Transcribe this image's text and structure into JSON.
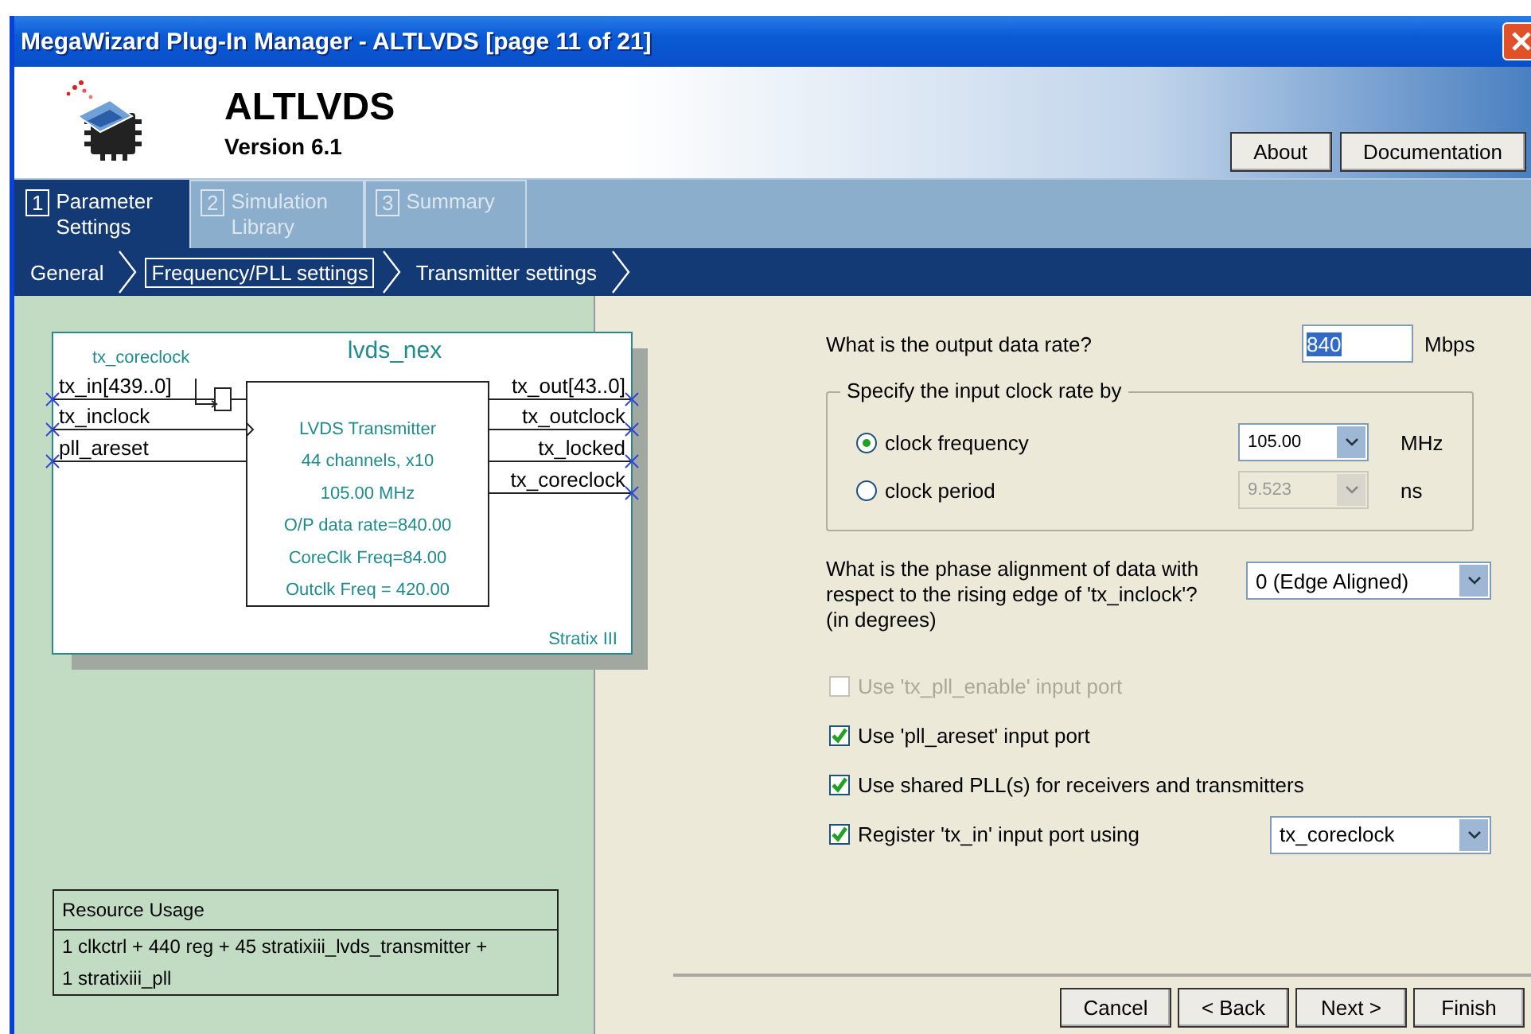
{
  "window": {
    "title": "MegaWizard Plug-In Manager - ALTLVDS [page 11 of 21]"
  },
  "header": {
    "title": "ALTLVDS",
    "version": "Version 6.1",
    "buttons": [
      "About",
      "Documentation"
    ]
  },
  "steps": [
    {
      "number": "1",
      "label": "Parameter Settings",
      "selected": true
    },
    {
      "number": "2",
      "label": "Simulation Library",
      "selected": false
    },
    {
      "number": "3",
      "label": "Summary",
      "selected": false
    }
  ],
  "breadcrumb": [
    {
      "label": "General",
      "selected": false
    },
    {
      "label": "Frequency/PLL settings",
      "selected": true
    },
    {
      "label": "Transmitter settings",
      "selected": false
    }
  ],
  "diagram": {
    "name": "lvds_nex",
    "clock_label": "tx_coreclock",
    "inputs": [
      "tx_in[439..0]",
      "tx_inclock",
      "pll_areset"
    ],
    "outputs": [
      "tx_out[43..0]",
      "tx_outclock",
      "tx_locked",
      "tx_coreclock"
    ],
    "block_lines": [
      "LVDS Transmitter",
      "44 channels, x10",
      "105.00 MHz",
      "O/P data rate=840.00",
      "CoreClk Freq=84.00",
      "Outclk Freq = 420.00"
    ],
    "family": "Stratix III"
  },
  "resource_usage": {
    "title": "Resource Usage",
    "lines": [
      "1 clkctrl + 440 reg + 45 stratixiii_lvds_transmitter +",
      "1 stratixiii_pll"
    ]
  },
  "data_rate": {
    "label": "What is the output data rate?",
    "value": "840",
    "unit": "Mbps"
  },
  "clock_group": {
    "legend": "Specify the input clock rate by",
    "options": [
      {
        "label": "clock frequency",
        "selected": true,
        "value": "105.00",
        "unit": "MHz",
        "disabled": false
      },
      {
        "label": "clock period",
        "selected": false,
        "value": "9.523",
        "unit": "ns",
        "disabled": true
      }
    ]
  },
  "phase": {
    "label": "What is the phase alignment of data with respect to the rising edge of 'tx_inclock'? (in degrees)",
    "value": "0 (Edge Aligned)"
  },
  "checkboxes": [
    {
      "label": "Use 'tx_pll_enable' input port",
      "checked": false,
      "disabled": true
    },
    {
      "label": "Use 'pll_areset' input port",
      "checked": true,
      "disabled": false
    },
    {
      "label": "Use shared PLL(s) for receivers and transmitters",
      "checked": true,
      "disabled": false
    },
    {
      "label": "Register 'tx_in' input port using",
      "checked": true,
      "disabled": false,
      "select": "tx_coreclock"
    }
  ],
  "buttons": [
    "Cancel",
    "< Back",
    "Next >",
    "Finish"
  ]
}
